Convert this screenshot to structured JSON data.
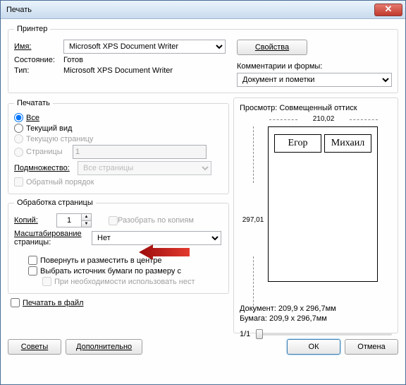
{
  "window": {
    "title": "Печать",
    "close": "✕"
  },
  "printer": {
    "legend": "Принтер",
    "name_label": "Имя:",
    "name_value": "Microsoft XPS Document Writer",
    "properties_btn": "Свойства",
    "status_label": "Состояние:",
    "status_value": "Готов",
    "type_label": "Тип:",
    "type_value": "Microsoft XPS Document Writer",
    "comments_label": "Комментарии и формы:",
    "comments_value": "Документ и пометки"
  },
  "range": {
    "legend": "Печатать",
    "all": "Все",
    "current_view": "Текущий вид",
    "current_page": "Текущую страницу",
    "pages": "Страницы",
    "pages_value": "1",
    "subset_label": "Подмножество:",
    "subset_value": "Все страницы",
    "reverse": "Обратный порядок"
  },
  "handling": {
    "legend": "Обработка страницы",
    "copies_label": "Копий:",
    "copies_value": "1",
    "collate": "Разобрать по копиям",
    "scale_label1": "Масштабирование",
    "scale_label2": "страницы:",
    "scale_value": "Нет",
    "rotate": "Повернуть и разместить в центре",
    "paper_source": "Выбрать источник бумаги по размеру с",
    "custom_when_needed": "При необходимости использовать нест"
  },
  "print_to_file": "Печатать в файл",
  "preview": {
    "label": "Просмотр: Совмещенный оттиск",
    "width": "210,02",
    "height": "297,01",
    "cell1": "Егор",
    "cell2": "Михаил",
    "doc": "Документ: 209,9 x 296,7мм",
    "paper": "Бумага: 209,9 x 296,7мм",
    "page_counter": "1/1"
  },
  "footer": {
    "tips": "Советы",
    "advanced": "Дополнительно",
    "ok": "ОК",
    "cancel": "Отмена"
  },
  "chart_data": {
    "type": "table",
    "title": "Print preview page",
    "page_size_mm": {
      "width": 210.02,
      "height": 297.01
    },
    "cells": [
      "Егор",
      "Михаил"
    ]
  }
}
